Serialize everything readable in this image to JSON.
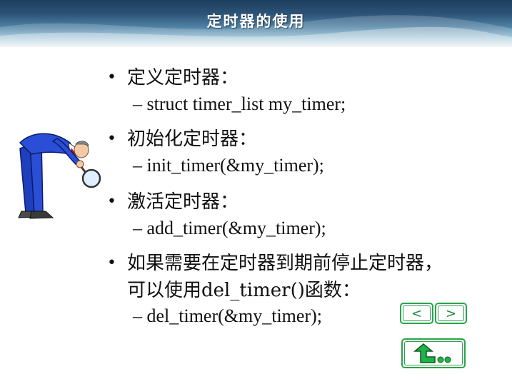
{
  "slide": {
    "title": "定时器的使用",
    "items": [
      {
        "bullet": "•",
        "text": "定义定时器：",
        "sub": "– struct timer_list my_timer;"
      },
      {
        "bullet": "•",
        "text": "初始化定时器：",
        "sub": "– init_timer(&my_timer);"
      },
      {
        "bullet": "•",
        "text": "激活定时器：",
        "sub": "– add_timer(&my_timer);"
      },
      {
        "bullet": "•",
        "text": "如果需要在定时器到期前停止定时器，",
        "text2": "可以使用del_timer()函数：",
        "sub": "– del_timer(&my_timer);"
      }
    ]
  },
  "nav": {
    "prev_label": "<",
    "next_label": ">",
    "home_icon": "return-arrow-icon"
  },
  "colors": {
    "header_dark": "#1d3d5d",
    "nav_green": "#2aa34a"
  }
}
